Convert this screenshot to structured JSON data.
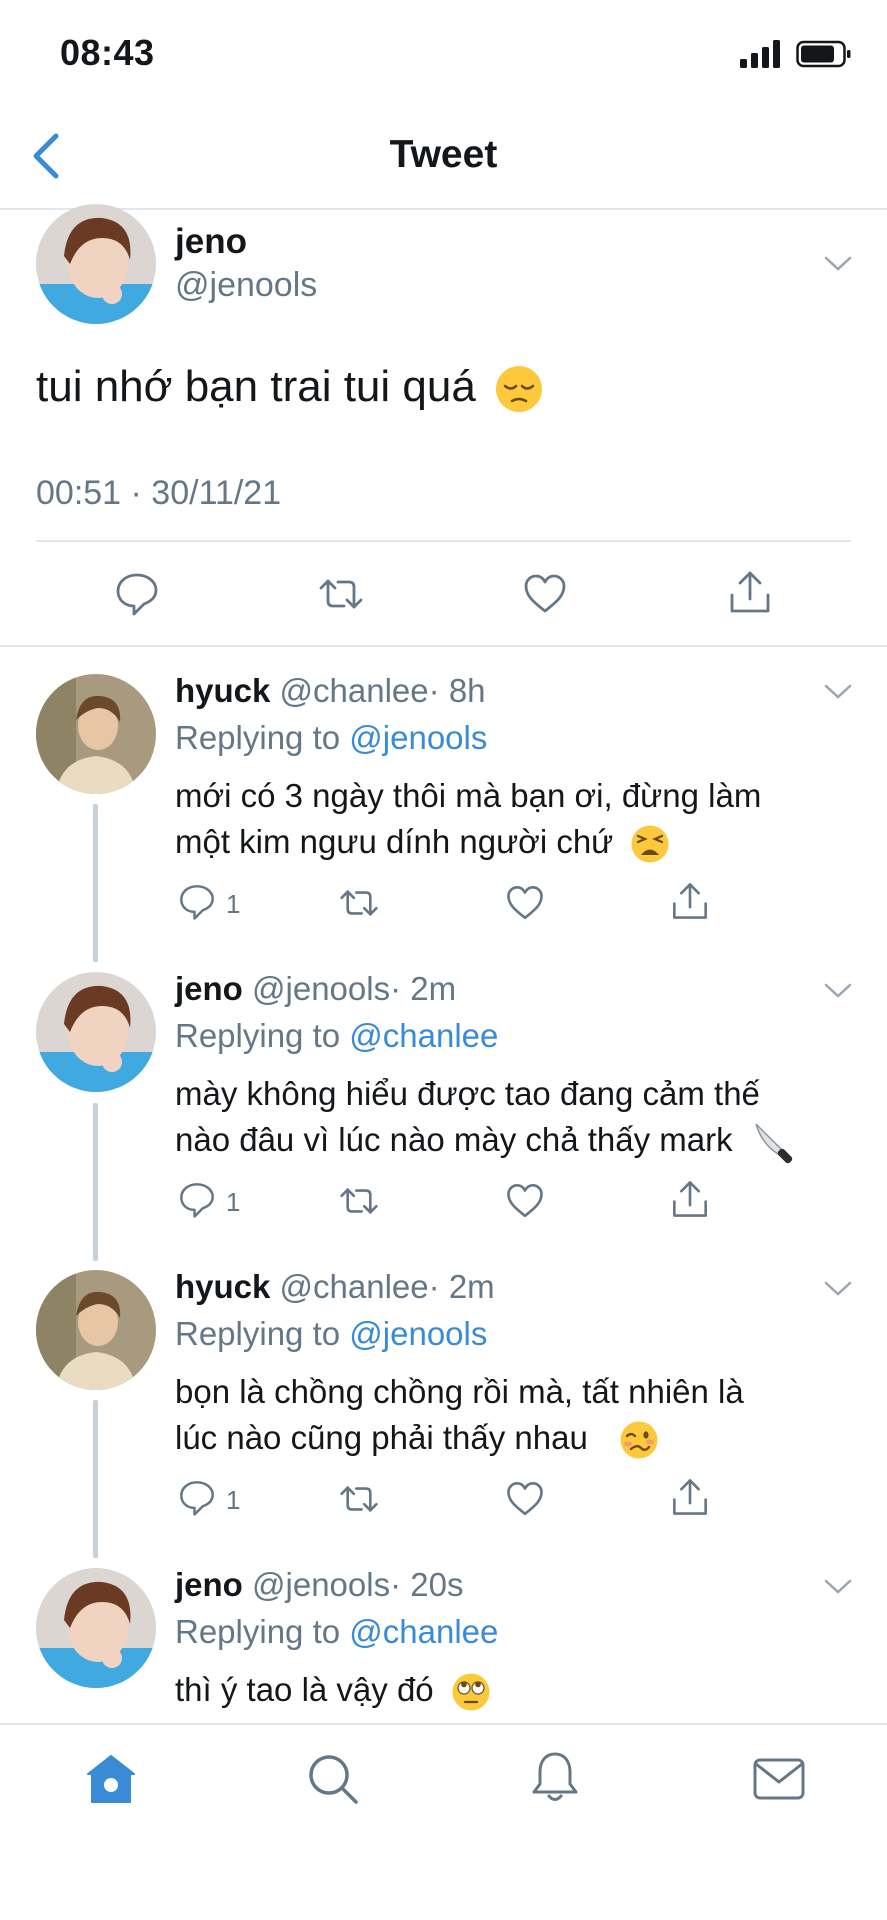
{
  "status_bar": {
    "time": "08:43"
  },
  "header": {
    "title": "Tweet"
  },
  "main_tweet": {
    "name": "jeno",
    "handle": "@jenools",
    "text": "tui nhớ bạn trai tui quá",
    "timestamp": "00:51 · 30/11/21"
  },
  "replies": [
    {
      "name": "hyuck",
      "handle": "@chanlee",
      "time": "· 8h",
      "replying_label": "Replying to",
      "replying_to": "@jenools",
      "line1": "mới có 3 ngày thôi mà bạn ơi, đừng làm",
      "line2": "một kim ngưu dính người chứ",
      "reply_count": "1",
      "emoji": "tired-face"
    },
    {
      "name": "jeno",
      "handle": "@jenools",
      "time": "· 2m",
      "replying_label": "Replying to",
      "replying_to": "@chanlee",
      "line1": "mày không hiểu được tao đang cảm thế",
      "line2": "nào đâu vì lúc nào mày chả thấy mark",
      "reply_count": "1",
      "emoji": "knife"
    },
    {
      "name": "hyuck",
      "handle": "@chanlee",
      "time": "· 2m",
      "replying_label": "Replying to",
      "replying_to": "@jenools",
      "line1": "bọn là chồng chồng rồi mà, tất nhiên là",
      "line2": "lúc nào cũng phải thấy nhau",
      "reply_count": "1",
      "emoji": "woozy-face"
    },
    {
      "name": "jeno",
      "handle": "@jenools",
      "time": "· 20s",
      "replying_label": "Replying to",
      "replying_to": "@chanlee",
      "line1": "thì ý tao là vậy đó",
      "emoji": "eye-roll-face"
    }
  ],
  "colors": {
    "accent": "#3a8bd6",
    "muted": "#657786",
    "divider": "#e1e8ed"
  },
  "tab_bar": [
    "home-icon",
    "search-icon",
    "bell-icon",
    "mail-icon"
  ]
}
